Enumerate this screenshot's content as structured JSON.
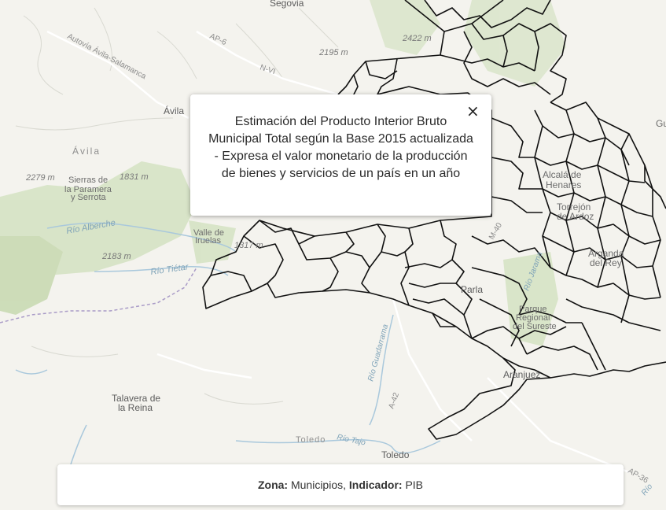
{
  "map": {
    "basemap_labels": {
      "segovia": "Segovia",
      "autovia_avila": "Autovía Ávila-Salamanca",
      "ap6": "AP-6",
      "nvi": "N-VI",
      "elev_2422": "2422 m",
      "elev_2195": "2195 m",
      "avila_city": "Ávila",
      "avila_region": "Ávila",
      "elev_2279": "2279 m",
      "sierras_1": "Sierras de",
      "sierras_2": "la Paramera",
      "sierras_3": "y Serrota",
      "elev_1831": "1831 m",
      "rio_alberche": "Río Alberche",
      "valle_1": "Valle de",
      "valle_2": "Iruelas",
      "elev_1317": "1317 m",
      "elev_2183": "2183 m",
      "rio_tietar": "Río Tiétar",
      "alcala_1": "Alcalá de",
      "alcala_2": "Henares",
      "torrejon_1": "Torrejón",
      "torrejon_2": "de Ardoz",
      "arganda_1": "Arganda",
      "arganda_2": "del Rey",
      "parla": "Parla",
      "parque_1": "Parque",
      "parque_2": "Regional",
      "parque_3": "del Sureste",
      "m40": "M-40",
      "rio_guadarrama": "Río Guadarrama",
      "rio_jarama": "Río Jarama",
      "aranjuez": "Aranjuez",
      "talavera_1": "Talavera de",
      "talavera_2": "la Reina",
      "a42": "A-42",
      "toledo_region": "Toledo",
      "rio_tajo": "Río Tajo",
      "toledo_city": "Toledo",
      "ap36": "AP-36",
      "gu": "Gu",
      "rio_right": "Río"
    },
    "colors": {
      "land": "#f4f3ee",
      "forest": "#d4e2c2",
      "water": "#a9c8dc",
      "boundary": "#111111"
    }
  },
  "popup": {
    "text": "Estimación del Producto Interior Bruto Municipal Total según la Base 2015 actualizada - Expresa el valor monetario de la producción de bienes y servicios de un país en un año",
    "close": "×"
  },
  "footer": {
    "zona_label": "Zona:",
    "zona_value": "Municipios,",
    "indicador_label": "Indicador:",
    "indicador_value": "PIB"
  }
}
